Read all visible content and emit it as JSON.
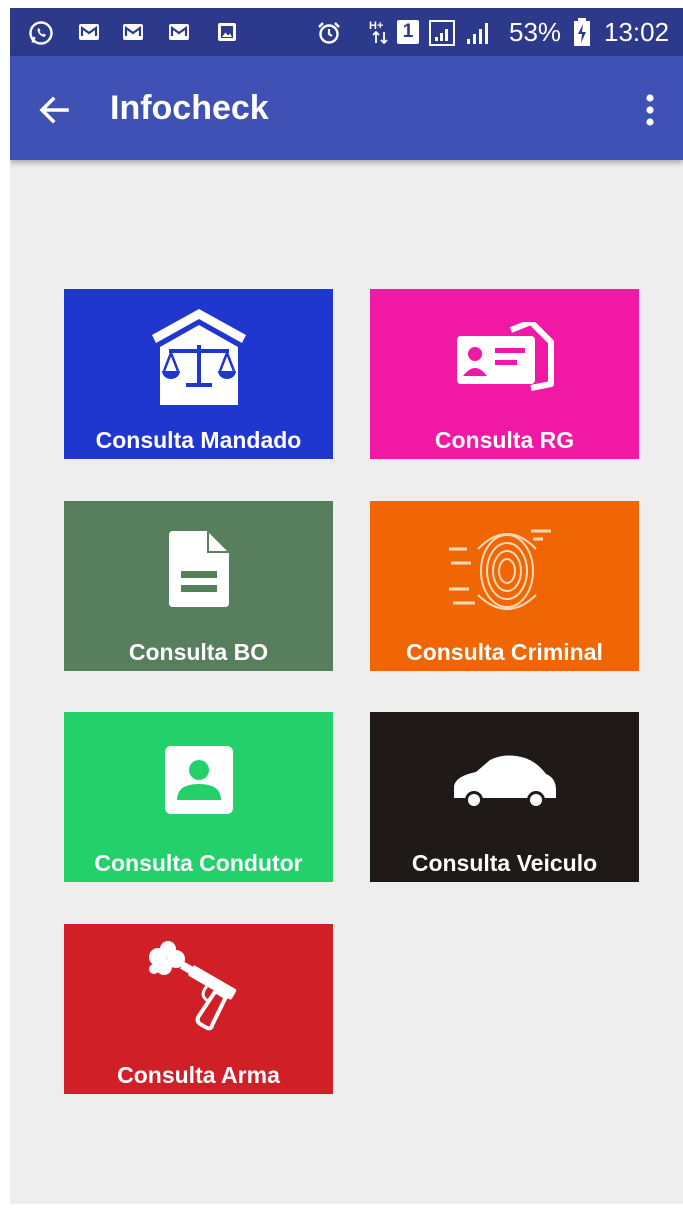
{
  "status_bar": {
    "battery": "53%",
    "time": "13:02",
    "network": "H+",
    "sim": "1",
    "icons": [
      "whatsapp-icon",
      "gmail-icon",
      "gmail-icon",
      "gmail-icon",
      "image-icon",
      "alarm-icon",
      "signal-icon",
      "signal-icon",
      "battery-charging-icon"
    ]
  },
  "app_bar": {
    "title": "Infocheck",
    "back_icon": "arrow-back-icon",
    "menu_icon": "more-vert-icon"
  },
  "tiles": [
    {
      "label": "Consulta Mandado",
      "color": "#1f36cf",
      "icon": "courthouse-scales-icon"
    },
    {
      "label": "Consulta RG",
      "color": "#f218a6",
      "icon": "id-card-icon"
    },
    {
      "label": "Consulta BO",
      "color": "#577e5d",
      "icon": "document-icon"
    },
    {
      "label": "Consulta Criminal",
      "color": "#f06605",
      "icon": "fingerprint-icon"
    },
    {
      "label": "Consulta Condutor",
      "color": "#24d06a",
      "icon": "contact-card-icon"
    },
    {
      "label": "Consulta Veiculo",
      "color": "#1f1a18",
      "icon": "car-icon"
    },
    {
      "label": "Consulta Arma",
      "color": "#d11f28",
      "icon": "gun-icon"
    }
  ]
}
